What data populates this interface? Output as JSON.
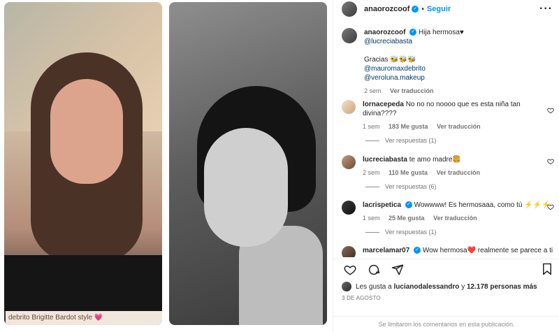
{
  "post": {
    "author": "anaorozcoof",
    "follow_label": "Seguir",
    "more_label": "···"
  },
  "caption": {
    "username": "anaorozcoof",
    "text": "Hija hermosa♥",
    "mention_1": "@lucreciabasta",
    "gracias": "Gracias 🐝🐝🐝",
    "mention_2": "@mauromaxdebrito",
    "mention_3": "@veroluna.makeup",
    "time": "2 sem",
    "translate": "Ver traducción"
  },
  "comments": [
    {
      "username": "lornacepeda",
      "text": "No no no noooo que es esta niña tan divina????",
      "time": "1 sem",
      "likes": "183 Me gusta",
      "translate": "Ver traducción",
      "replies": "Ver respuestas (1)"
    },
    {
      "username": "lucreciabasta",
      "text": "te amo madre🍔",
      "time": "2 sem",
      "likes": "110 Me gusta",
      "translate": "Ver traducción",
      "replies": "Ver respuestas (6)"
    },
    {
      "username": "lacrispetica",
      "text": "Wowwww! Es hermosaaa, como tú ⚡⚡⚡",
      "time": "1 sem",
      "likes": "25 Me gusta",
      "translate": "Ver traducción",
      "replies": "Ver respuestas (1)"
    },
    {
      "username": "marcelamar07",
      "text": "Wow hermosa❤️ realmente se parece a ti"
    }
  ],
  "likes_line": {
    "prefix": "Les gusta a",
    "user": "lucianodalessandro",
    "joiner": "y",
    "others": "12.178 personas más"
  },
  "date": "3 DE AGOSTO",
  "limited_comments": "Se limitaron los comentarios en esta publicación.",
  "photo_caption": "debrito Brigitte Bardot style 💗",
  "colors": {
    "link": "#00376b",
    "accent": "#0095f6",
    "muted": "#737373"
  }
}
